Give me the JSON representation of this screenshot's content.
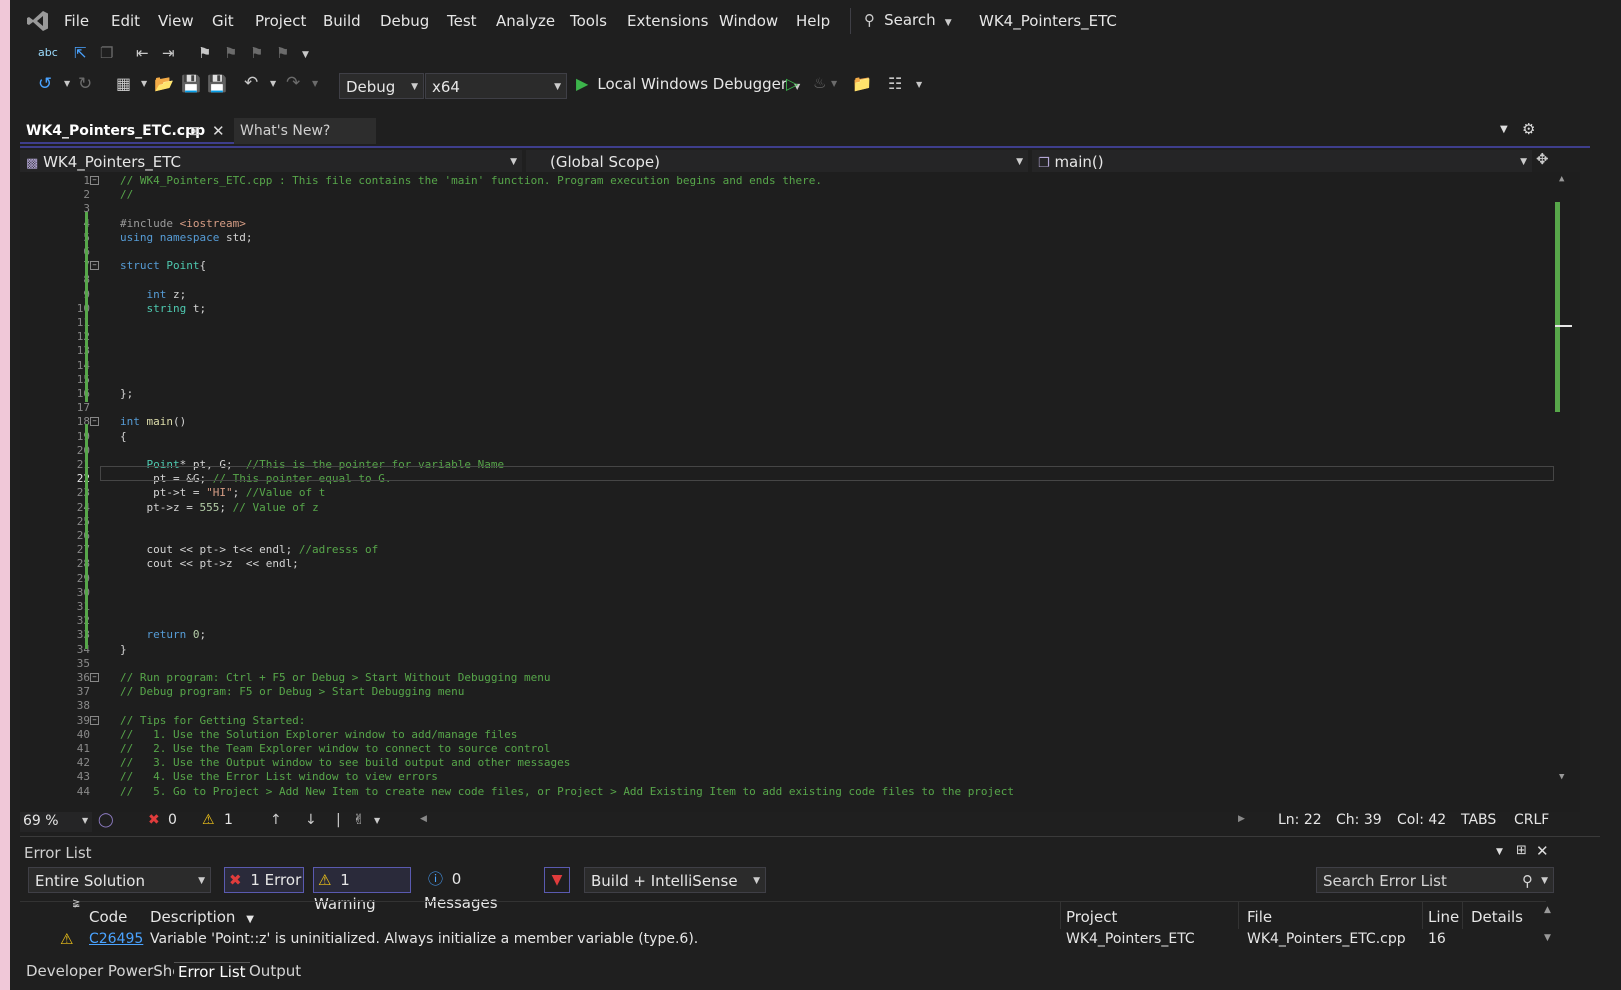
{
  "menu": [
    "File",
    "Edit",
    "View",
    "Git",
    "Project",
    "Build",
    "Debug",
    "Test",
    "Analyze",
    "Tools",
    "Extensions",
    "Window",
    "Help"
  ],
  "search_label": "Search",
  "solution_title": "WK4_Pointers_ETC",
  "toolbar": {
    "config": "Debug",
    "platform": "x64",
    "run_label": "Local Windows Debugger"
  },
  "tabs": [
    {
      "label": "WK4_Pointers_ETC.cpp"
    },
    {
      "label": "What's New?"
    }
  ],
  "navbar": {
    "project": "WK4_Pointers_ETC",
    "scope": "(Global Scope)",
    "member": "main()"
  },
  "code_lines": [
    {
      "n": "1",
      "text": "// WK4_Pointers_ETC.cpp : This file contains the 'main' function. Program execution begins and ends there."
    },
    {
      "n": "2",
      "text": "//"
    },
    {
      "n": "3",
      "text": ""
    },
    {
      "n": "4",
      "text": "#include <iostream>"
    },
    {
      "n": "5",
      "text": "using namespace std;"
    },
    {
      "n": "6",
      "text": ""
    },
    {
      "n": "7",
      "text": "struct Point{"
    },
    {
      "n": "8",
      "text": ""
    },
    {
      "n": "9",
      "text": "    int z;"
    },
    {
      "n": "10",
      "text": "    string t;"
    },
    {
      "n": "11",
      "text": ""
    },
    {
      "n": "12",
      "text": ""
    },
    {
      "n": "13",
      "text": ""
    },
    {
      "n": "14",
      "text": ""
    },
    {
      "n": "15",
      "text": ""
    },
    {
      "n": "16",
      "text": "};"
    },
    {
      "n": "17",
      "text": ""
    },
    {
      "n": "18",
      "text": "int main()"
    },
    {
      "n": "19",
      "text": "{"
    },
    {
      "n": "20",
      "text": ""
    },
    {
      "n": "21",
      "text": "    Point* pt, G;  //This is the pointer for variable Name"
    },
    {
      "n": "22",
      "text": "     pt = &G; // This pointer equal to G."
    },
    {
      "n": "23",
      "text": "     pt->t = \"HI\"; //Value of t"
    },
    {
      "n": "24",
      "text": "    pt->z = 555; // Value of z"
    },
    {
      "n": "25",
      "text": ""
    },
    {
      "n": "26",
      "text": ""
    },
    {
      "n": "27",
      "text": "    cout << pt-> t<< endl; //adresss of"
    },
    {
      "n": "28",
      "text": "    cout << pt->z  << endl;"
    },
    {
      "n": "29",
      "text": ""
    },
    {
      "n": "30",
      "text": ""
    },
    {
      "n": "31",
      "text": ""
    },
    {
      "n": "32",
      "text": ""
    },
    {
      "n": "33",
      "text": "    return 0;"
    },
    {
      "n": "34",
      "text": "}"
    },
    {
      "n": "35",
      "text": ""
    },
    {
      "n": "36",
      "text": "// Run program: Ctrl + F5 or Debug > Start Without Debugging menu"
    },
    {
      "n": "37",
      "text": "// Debug program: F5 or Debug > Start Debugging menu"
    },
    {
      "n": "38",
      "text": ""
    },
    {
      "n": "39",
      "text": "// Tips for Getting Started:"
    },
    {
      "n": "40",
      "text": "//   1. Use the Solution Explorer window to add/manage files"
    },
    {
      "n": "41",
      "text": "//   2. Use the Team Explorer window to connect to source control"
    },
    {
      "n": "42",
      "text": "//   3. Use the Output window to see build output and other messages"
    },
    {
      "n": "43",
      "text": "//   4. Use the Error List window to view errors"
    },
    {
      "n": "44",
      "text": "//   5. Go to Project > Add New Item to create new code files, or Project > Add Existing Item to add existing code files to the project"
    }
  ],
  "status": {
    "zoom": "69 %",
    "errors": "0",
    "warnings": "1",
    "ln": "Ln: 22",
    "ch": "Ch: 39",
    "col": "Col: 42",
    "tabs": "TABS",
    "eol": "CRLF"
  },
  "error_list": {
    "title": "Error List",
    "scope": "Entire Solution",
    "error_btn": "1 Error",
    "warning_btn": "1 Warning",
    "messages_btn": "0 Messages",
    "source": "Build + IntelliSense",
    "search_placeholder": "Search Error List",
    "headers": [
      "Code",
      "Description",
      "Project",
      "File",
      "Line",
      "Details"
    ],
    "rows": [
      {
        "code": "C26495",
        "description": "Variable 'Point::z' is uninitialized. Always initialize a member variable (type.6).",
        "project": "WK4_Pointers_ETC",
        "file": "WK4_Pointers_ETC.cpp",
        "line": "16"
      }
    ]
  },
  "bottom_tabs": [
    "Developer PowerShell",
    "Error List",
    "Output"
  ],
  "colors": {
    "accent": "#3e3e8c",
    "keyword": "#569cd6",
    "type": "#4ec9b0",
    "comment": "#57a64a",
    "string": "#d69d85",
    "run": "#3cb44b"
  }
}
